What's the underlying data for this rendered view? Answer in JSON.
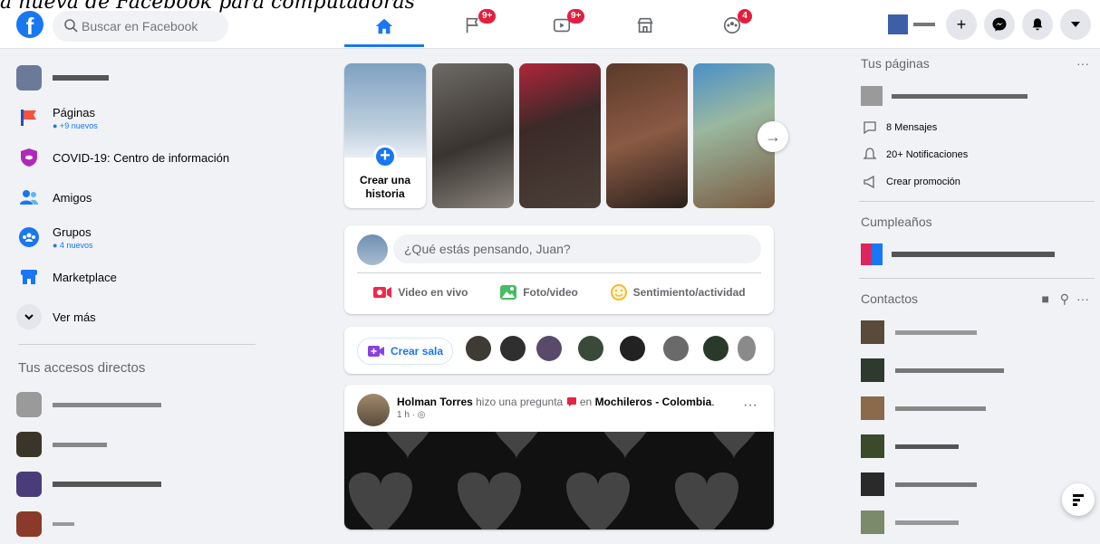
{
  "overlay_caption": "a nueva de Facebook para computadoras",
  "header": {
    "logo": "f",
    "search_placeholder": "Buscar en Facebook",
    "tabs": [
      {
        "name": "home-icon",
        "badge": ""
      },
      {
        "name": "flag-icon",
        "badge": "9+"
      },
      {
        "name": "watch-icon",
        "badge": "9+"
      },
      {
        "name": "marketplace-icon",
        "badge": ""
      },
      {
        "name": "groups-icon",
        "badge": "4"
      }
    ]
  },
  "left": {
    "items": [
      {
        "label": "",
        "sub": ""
      },
      {
        "label": "Páginas",
        "sub": "● +9 nuevos"
      },
      {
        "label": "COVID-19: Centro de información",
        "sub": ""
      },
      {
        "label": "Amigos",
        "sub": ""
      },
      {
        "label": "Grupos",
        "sub": "● 4 nuevos"
      },
      {
        "label": "Marketplace",
        "sub": ""
      },
      {
        "label": "Ver más",
        "sub": ""
      }
    ],
    "shortcuts_title": "Tus accesos directos"
  },
  "stories": {
    "create_label": "Crear una historia"
  },
  "composer": {
    "placeholder": "¿Qué estás pensando, Juan?",
    "live": "Video en vivo",
    "photo": "Foto/video",
    "feeling": "Sentimiento/actividad"
  },
  "rooms": {
    "create_room": "Crear sala"
  },
  "post": {
    "author": "Holman Torres",
    "action": " hizo una pregunta ",
    "in_word": " en ",
    "group": "Mochileros - Colombia",
    "meta": "1 h · ◎"
  },
  "right": {
    "pages_title": "Tus páginas",
    "messages": "8 Mensajes",
    "notifications": "20+ Notificaciones",
    "promo": "Crear promoción",
    "birthdays_title": "Cumpleaños",
    "contacts_title": "Contactos"
  },
  "colors": {
    "accent": "#1877f2",
    "badge": "#e41e3f"
  }
}
